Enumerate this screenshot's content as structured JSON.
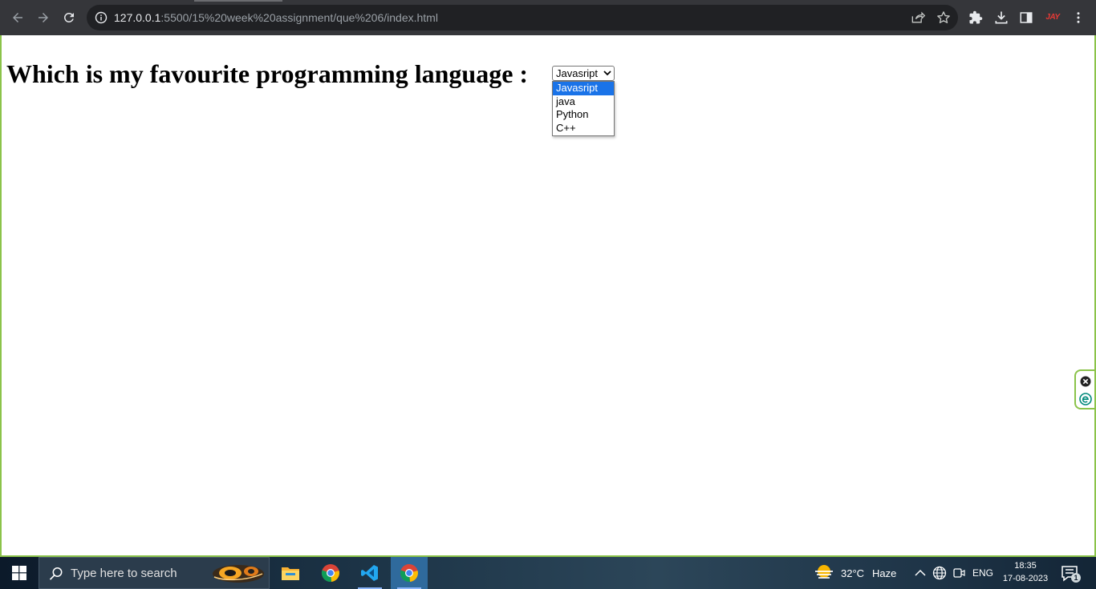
{
  "browser": {
    "url_host": "127.0.0.1",
    "url_path": ":5500/15%20week%20assignment/que%206/index.html",
    "extension_badge": "JAY"
  },
  "page": {
    "heading": "Which is my favourite programming language :",
    "select": {
      "selected": "Javasript",
      "options": [
        "Javasript",
        "java",
        "Python",
        "C++"
      ]
    }
  },
  "taskbar": {
    "search_placeholder": "Type here to search",
    "weather": {
      "temperature": "32°C",
      "condition": "Haze"
    },
    "language": "ENG",
    "time": "18:35",
    "date": "17-08-2023",
    "notification_count": "1"
  },
  "colors": {
    "chrome_toolbar": "#35363a",
    "omnibox": "#202124",
    "selected_option": "#1a73e8",
    "window_border": "#8bc34a"
  }
}
